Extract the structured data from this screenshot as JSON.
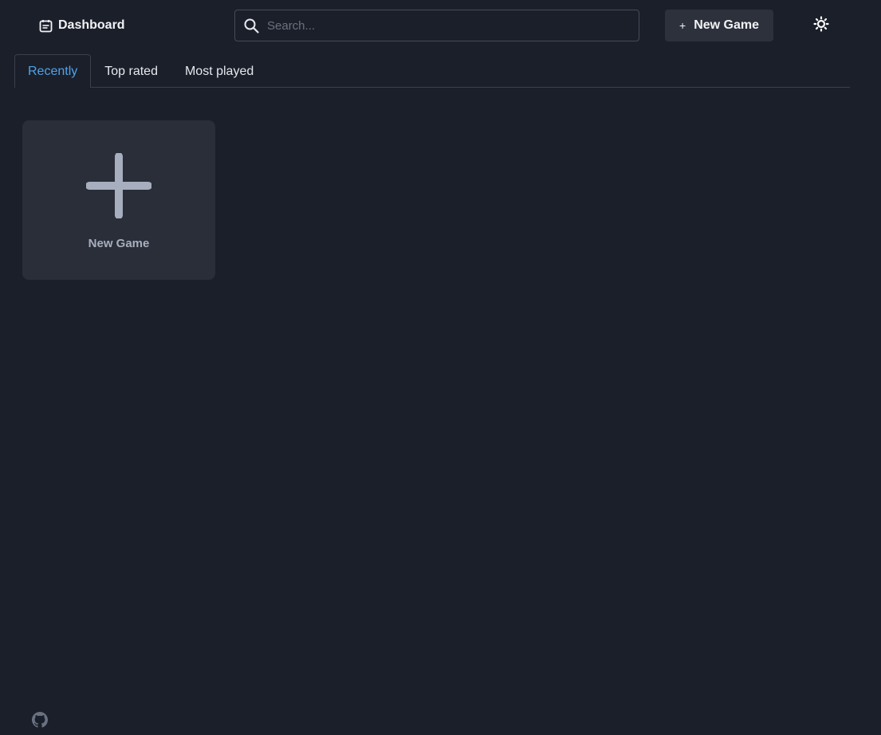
{
  "header": {
    "dashboard_label": "Dashboard",
    "dashboard_icon": "clipboard-icon",
    "search_placeholder": "Search...",
    "new_game_label": "New Game",
    "theme_icon": "sun-icon"
  },
  "tabs": [
    {
      "label": "Recently",
      "active": true
    },
    {
      "label": "Top rated",
      "active": false
    },
    {
      "label": "Most played",
      "active": false
    }
  ],
  "cards": [
    {
      "label": "New Game",
      "icon": "plus-icon"
    }
  ],
  "footer": {
    "github_icon": "github-icon"
  },
  "colors": {
    "background": "#1b1f2a",
    "accent": "#4ea3ea",
    "card": "#2a2e39",
    "button": "#2d313c"
  }
}
